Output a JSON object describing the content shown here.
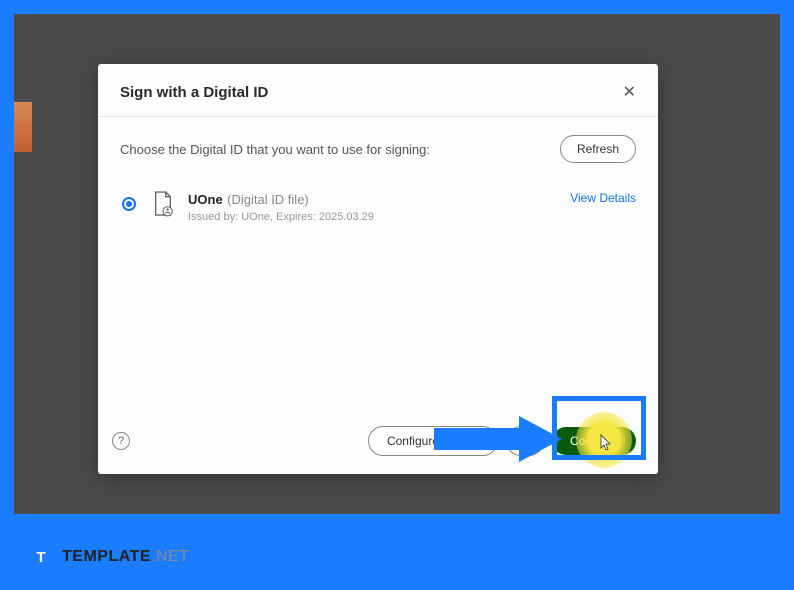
{
  "dialog": {
    "title": "Sign with a Digital ID",
    "instruction": "Choose the Digital ID that you want to use for signing:",
    "refresh_label": "Refresh",
    "id": {
      "name": "UOne",
      "type": "(Digital ID file)",
      "meta": "Issued by: UOne, Expires: 2025.03.29"
    },
    "view_details": "View Details",
    "footer": {
      "configure_label": "Configure New Digital ID",
      "cancel_label": "Cancel",
      "continue_label": "Continue"
    },
    "help_glyph": "?"
  },
  "watermark": {
    "icon_letter": "T",
    "text": "TEMPLATE",
    "suffix": ".NET"
  }
}
